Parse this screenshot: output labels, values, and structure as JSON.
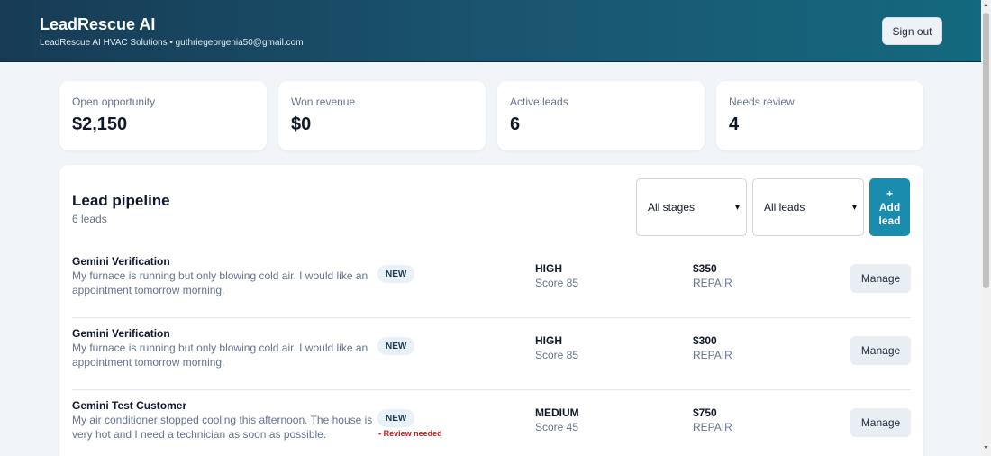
{
  "header": {
    "title": "LeadRescue AI",
    "subtitle": "LeadRescue AI HVAC Solutions • guthriegeorgenia50@gmail.com",
    "signout_label": "Sign out"
  },
  "stats": [
    {
      "label": "Open opportunity",
      "value": "$2,150"
    },
    {
      "label": "Won revenue",
      "value": "$0"
    },
    {
      "label": "Active leads",
      "value": "6"
    },
    {
      "label": "Needs review",
      "value": "4"
    }
  ],
  "pipeline": {
    "title": "Lead pipeline",
    "count": "6 leads",
    "stage_filter": {
      "selected": "All stages"
    },
    "lead_filter": {
      "selected": "All leads"
    },
    "add_plus": "+",
    "add_line1": "Add",
    "add_line2": "lead",
    "leads": [
      {
        "name": "Gemini Verification",
        "description": "My furnace is running but only blowing cold air. I would like an appointment tomorrow morning.",
        "status": "NEW",
        "review": "",
        "priority": "HIGH",
        "score": "Score 85",
        "amount": "$350",
        "job_type": "REPAIR",
        "action": "Manage"
      },
      {
        "name": "Gemini Verification",
        "description": "My furnace is running but only blowing cold air. I would like an appointment tomorrow morning.",
        "status": "NEW",
        "review": "",
        "priority": "HIGH",
        "score": "Score 85",
        "amount": "$300",
        "job_type": "REPAIR",
        "action": "Manage"
      },
      {
        "name": "Gemini Test Customer",
        "description": "My air conditioner stopped cooling this afternoon. The house is very hot and I need a technician as soon as possible.",
        "status": "NEW",
        "review": "• Review needed",
        "priority": "MEDIUM",
        "score": "Score 45",
        "amount": "$750",
        "job_type": "REPAIR",
        "action": "Manage"
      }
    ]
  },
  "icons": {
    "select_chevron": "chevron-down-icon",
    "scroll_up": "arrow-up-icon",
    "scroll_down": "arrow-down-icon"
  },
  "colors": {
    "accent": "#1a8cad",
    "review": "#b91c1c",
    "header_start": "#173b55",
    "header_end": "#13697f"
  }
}
